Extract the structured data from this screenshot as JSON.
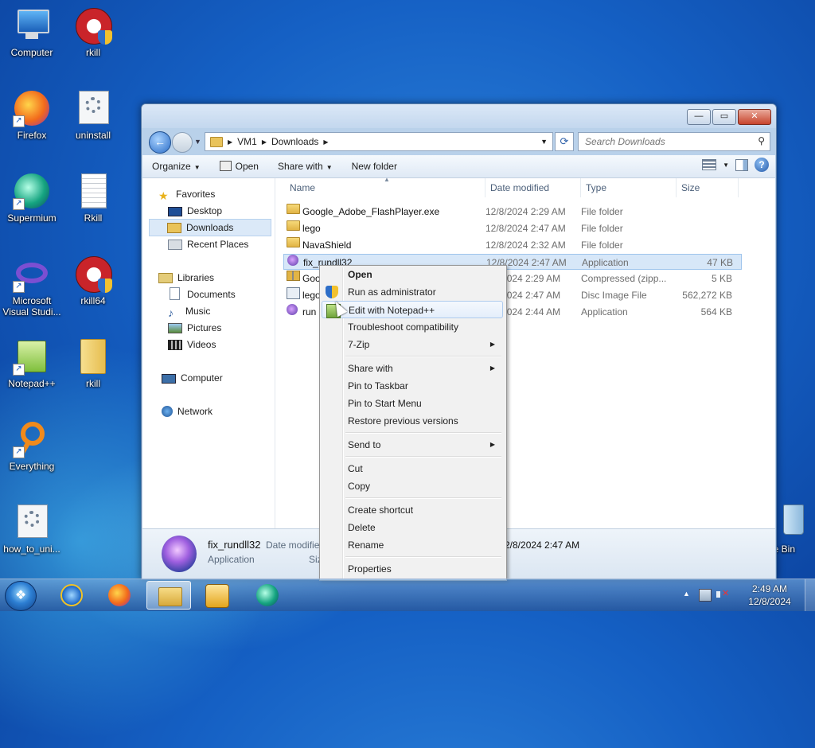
{
  "desktop": {
    "icons": [
      {
        "label": "Computer",
        "icon": "computer-icon"
      },
      {
        "label": "rkill",
        "icon": "rkill-icon"
      },
      {
        "label": "Firefox",
        "icon": "firefox-icon"
      },
      {
        "label": "uninstall",
        "icon": "settings-file-icon"
      },
      {
        "label": "Supermium",
        "icon": "supermium-icon"
      },
      {
        "label": "Rkill",
        "icon": "text-file-icon"
      },
      {
        "label": "Microsoft Visual Studi...",
        "icon": "visual-studio-icon"
      },
      {
        "label": "rkill64",
        "icon": "rkill-icon"
      },
      {
        "label": "Notepad++",
        "icon": "notepadpp-icon"
      },
      {
        "label": "rkill",
        "icon": "folder-icon"
      },
      {
        "label": "Everything",
        "icon": "everything-icon"
      },
      {
        "label": "how_to_uni...",
        "icon": "settings-file-icon"
      },
      {
        "label": "le Bin",
        "icon": "recycle-bin-icon"
      }
    ]
  },
  "explorer": {
    "address": {
      "root": "VM1",
      "folder": "Downloads"
    },
    "search_placeholder": "Search Downloads",
    "toolbar": {
      "organize": "Organize",
      "open": "Open",
      "share_with": "Share with",
      "new_folder": "New folder"
    },
    "nav": {
      "favorites": "Favorites",
      "desktop": "Desktop",
      "downloads": "Downloads",
      "recent_places": "Recent Places",
      "libraries": "Libraries",
      "documents": "Documents",
      "music": "Music",
      "pictures": "Pictures",
      "videos": "Videos",
      "computer": "Computer",
      "network": "Network"
    },
    "columns": {
      "name": "Name",
      "date_modified": "Date modified",
      "type": "Type",
      "size": "Size"
    },
    "files": [
      {
        "name": "Google_Adobe_FlashPlayer.exe",
        "date": "12/8/2024 2:29 AM",
        "type": "File folder",
        "size": "",
        "icon": "folder-icon"
      },
      {
        "name": "lego",
        "date": "12/8/2024 2:47 AM",
        "type": "File folder",
        "size": "",
        "icon": "folder-icon"
      },
      {
        "name": "NavaShield",
        "date": "12/8/2024 2:32 AM",
        "type": "File folder",
        "size": "",
        "icon": "folder-icon"
      },
      {
        "name": "fix_rundll32",
        "date": "12/8/2024 2:47 AM",
        "type": "Application",
        "size": "47 KB",
        "icon": "application-icon"
      },
      {
        "name": "Goo",
        "date": "2/8/2024 2:29 AM",
        "type": "Compressed (zipp...",
        "size": "5 KB",
        "icon": "zip-icon"
      },
      {
        "name": "lego",
        "date": "2/8/2024 2:47 AM",
        "type": "Disc Image File",
        "size": "562,272 KB",
        "icon": "disc-image-icon"
      },
      {
        "name": "run",
        "date": "2/8/2024 2:44 AM",
        "type": "Application",
        "size": "564 KB",
        "icon": "application-icon"
      }
    ],
    "details": {
      "name": "fix_rundll32",
      "type": "Application",
      "date_label": "Date modifie",
      "size_label": "Siz",
      "date_value": "2/8/2024 2:47 AM"
    }
  },
  "context_menu": {
    "items": [
      {
        "label": "Open",
        "submenu": false
      },
      {
        "label": "Run as administrator",
        "submenu": false
      },
      {
        "label": "Edit with Notepad++",
        "submenu": false
      },
      {
        "label": "Troubleshoot compatibility",
        "submenu": false
      },
      {
        "label": "7-Zip",
        "submenu": true
      },
      {
        "label": "Share with",
        "submenu": true
      },
      {
        "label": "Pin to Taskbar",
        "submenu": false
      },
      {
        "label": "Pin to Start Menu",
        "submenu": false
      },
      {
        "label": "Restore previous versions",
        "submenu": false
      },
      {
        "label": "Send to",
        "submenu": true
      },
      {
        "label": "Cut",
        "submenu": false
      },
      {
        "label": "Copy",
        "submenu": false
      },
      {
        "label": "Create shortcut",
        "submenu": false
      },
      {
        "label": "Delete",
        "submenu": false
      },
      {
        "label": "Rename",
        "submenu": false
      },
      {
        "label": "Properties",
        "submenu": false
      }
    ]
  },
  "taskbar": {
    "apps": [
      "internet-explorer-icon",
      "firefox-icon",
      "file-explorer-icon",
      "media-player-icon",
      "supermium-icon"
    ],
    "clock": {
      "time": "2:49 AM",
      "date": "12/8/2024"
    }
  }
}
